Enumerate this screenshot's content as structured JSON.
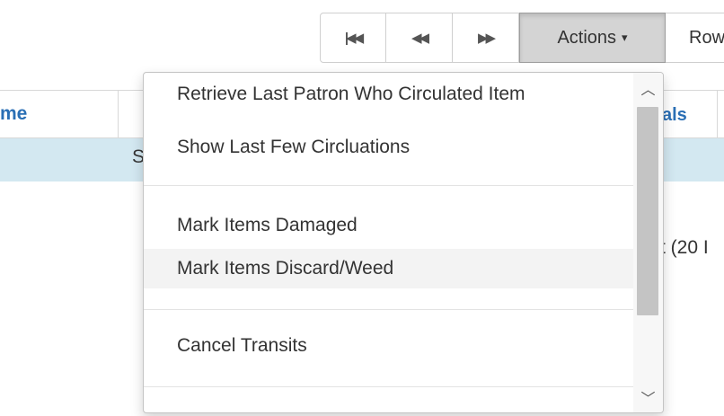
{
  "toolbar": {
    "first_icon": "first-page-icon",
    "first_glyph": "|◀◀",
    "prev_icon": "previous-page-icon",
    "prev_glyph": "◀◀",
    "next_icon": "next-page-icon",
    "next_glyph": "▶▶",
    "actions_label": "Actions",
    "actions_caret": "▾",
    "rows_label": "Rows"
  },
  "grid": {
    "col_name": "me",
    "col_renewals": "als",
    "band_text": "S",
    "count_text": "t (20 I"
  },
  "menu": {
    "items": [
      {
        "label": "Retrieve Last Patron Who Circulated Item"
      },
      {
        "label": "Show Last Few Circluations"
      },
      {
        "label": "Mark Items Damaged"
      },
      {
        "label": "Mark Items Discard/Weed"
      },
      {
        "label": "Cancel Transits"
      }
    ],
    "scroll_up_glyph": "︿",
    "scroll_down_glyph": "﹀"
  },
  "colors": {
    "link": "#2a6fb5",
    "band": "#d3e8f1",
    "active_button": "#d4d4d4",
    "hover_item": "#f3f3f3"
  }
}
